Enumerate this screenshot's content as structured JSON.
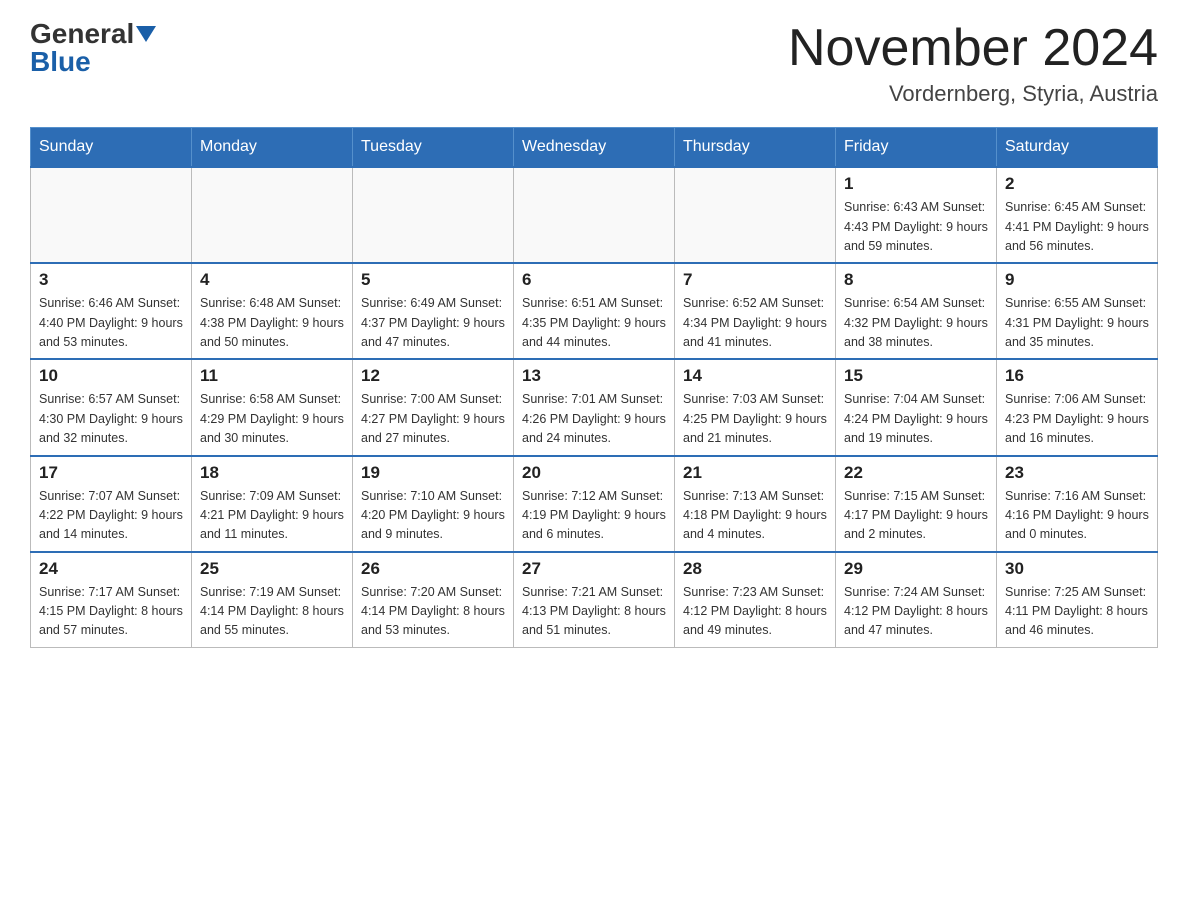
{
  "header": {
    "logo_general": "General",
    "logo_blue": "Blue",
    "month_title": "November 2024",
    "location": "Vordernberg, Styria, Austria"
  },
  "weekdays": [
    "Sunday",
    "Monday",
    "Tuesday",
    "Wednesday",
    "Thursday",
    "Friday",
    "Saturday"
  ],
  "weeks": [
    [
      {
        "day": "",
        "info": ""
      },
      {
        "day": "",
        "info": ""
      },
      {
        "day": "",
        "info": ""
      },
      {
        "day": "",
        "info": ""
      },
      {
        "day": "",
        "info": ""
      },
      {
        "day": "1",
        "info": "Sunrise: 6:43 AM\nSunset: 4:43 PM\nDaylight: 9 hours\nand 59 minutes."
      },
      {
        "day": "2",
        "info": "Sunrise: 6:45 AM\nSunset: 4:41 PM\nDaylight: 9 hours\nand 56 minutes."
      }
    ],
    [
      {
        "day": "3",
        "info": "Sunrise: 6:46 AM\nSunset: 4:40 PM\nDaylight: 9 hours\nand 53 minutes."
      },
      {
        "day": "4",
        "info": "Sunrise: 6:48 AM\nSunset: 4:38 PM\nDaylight: 9 hours\nand 50 minutes."
      },
      {
        "day": "5",
        "info": "Sunrise: 6:49 AM\nSunset: 4:37 PM\nDaylight: 9 hours\nand 47 minutes."
      },
      {
        "day": "6",
        "info": "Sunrise: 6:51 AM\nSunset: 4:35 PM\nDaylight: 9 hours\nand 44 minutes."
      },
      {
        "day": "7",
        "info": "Sunrise: 6:52 AM\nSunset: 4:34 PM\nDaylight: 9 hours\nand 41 minutes."
      },
      {
        "day": "8",
        "info": "Sunrise: 6:54 AM\nSunset: 4:32 PM\nDaylight: 9 hours\nand 38 minutes."
      },
      {
        "day": "9",
        "info": "Sunrise: 6:55 AM\nSunset: 4:31 PM\nDaylight: 9 hours\nand 35 minutes."
      }
    ],
    [
      {
        "day": "10",
        "info": "Sunrise: 6:57 AM\nSunset: 4:30 PM\nDaylight: 9 hours\nand 32 minutes."
      },
      {
        "day": "11",
        "info": "Sunrise: 6:58 AM\nSunset: 4:29 PM\nDaylight: 9 hours\nand 30 minutes."
      },
      {
        "day": "12",
        "info": "Sunrise: 7:00 AM\nSunset: 4:27 PM\nDaylight: 9 hours\nand 27 minutes."
      },
      {
        "day": "13",
        "info": "Sunrise: 7:01 AM\nSunset: 4:26 PM\nDaylight: 9 hours\nand 24 minutes."
      },
      {
        "day": "14",
        "info": "Sunrise: 7:03 AM\nSunset: 4:25 PM\nDaylight: 9 hours\nand 21 minutes."
      },
      {
        "day": "15",
        "info": "Sunrise: 7:04 AM\nSunset: 4:24 PM\nDaylight: 9 hours\nand 19 minutes."
      },
      {
        "day": "16",
        "info": "Sunrise: 7:06 AM\nSunset: 4:23 PM\nDaylight: 9 hours\nand 16 minutes."
      }
    ],
    [
      {
        "day": "17",
        "info": "Sunrise: 7:07 AM\nSunset: 4:22 PM\nDaylight: 9 hours\nand 14 minutes."
      },
      {
        "day": "18",
        "info": "Sunrise: 7:09 AM\nSunset: 4:21 PM\nDaylight: 9 hours\nand 11 minutes."
      },
      {
        "day": "19",
        "info": "Sunrise: 7:10 AM\nSunset: 4:20 PM\nDaylight: 9 hours\nand 9 minutes."
      },
      {
        "day": "20",
        "info": "Sunrise: 7:12 AM\nSunset: 4:19 PM\nDaylight: 9 hours\nand 6 minutes."
      },
      {
        "day": "21",
        "info": "Sunrise: 7:13 AM\nSunset: 4:18 PM\nDaylight: 9 hours\nand 4 minutes."
      },
      {
        "day": "22",
        "info": "Sunrise: 7:15 AM\nSunset: 4:17 PM\nDaylight: 9 hours\nand 2 minutes."
      },
      {
        "day": "23",
        "info": "Sunrise: 7:16 AM\nSunset: 4:16 PM\nDaylight: 9 hours\nand 0 minutes."
      }
    ],
    [
      {
        "day": "24",
        "info": "Sunrise: 7:17 AM\nSunset: 4:15 PM\nDaylight: 8 hours\nand 57 minutes."
      },
      {
        "day": "25",
        "info": "Sunrise: 7:19 AM\nSunset: 4:14 PM\nDaylight: 8 hours\nand 55 minutes."
      },
      {
        "day": "26",
        "info": "Sunrise: 7:20 AM\nSunset: 4:14 PM\nDaylight: 8 hours\nand 53 minutes."
      },
      {
        "day": "27",
        "info": "Sunrise: 7:21 AM\nSunset: 4:13 PM\nDaylight: 8 hours\nand 51 minutes."
      },
      {
        "day": "28",
        "info": "Sunrise: 7:23 AM\nSunset: 4:12 PM\nDaylight: 8 hours\nand 49 minutes."
      },
      {
        "day": "29",
        "info": "Sunrise: 7:24 AM\nSunset: 4:12 PM\nDaylight: 8 hours\nand 47 minutes."
      },
      {
        "day": "30",
        "info": "Sunrise: 7:25 AM\nSunset: 4:11 PM\nDaylight: 8 hours\nand 46 minutes."
      }
    ]
  ]
}
